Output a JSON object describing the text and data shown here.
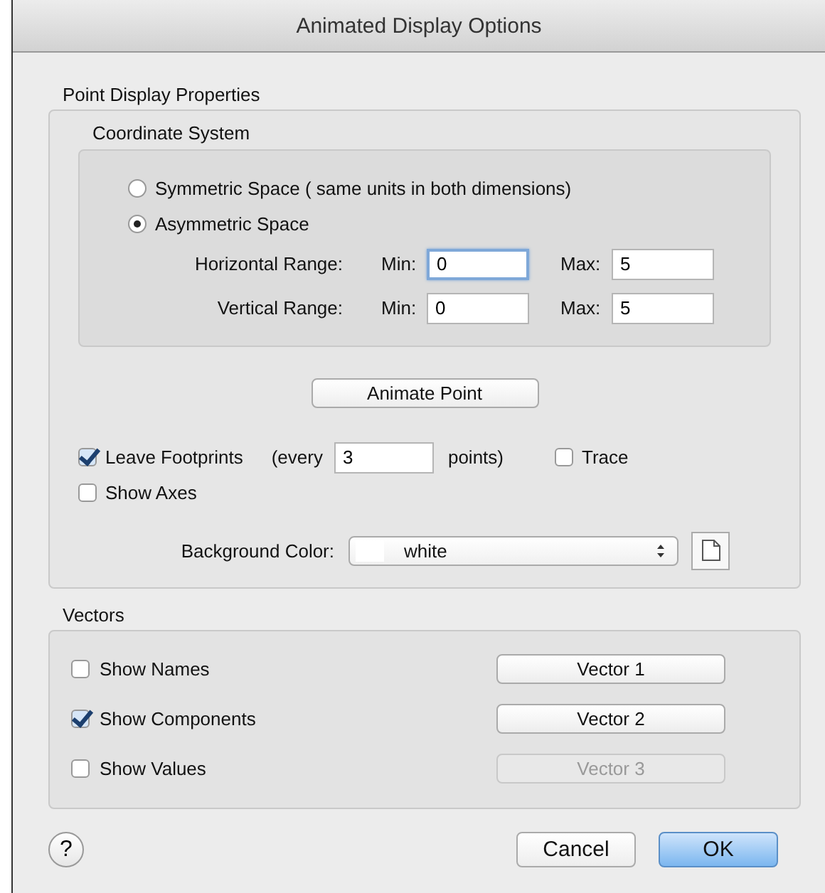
{
  "window": {
    "title": "Animated Display Options"
  },
  "point_display": {
    "label": "Point Display Properties",
    "coordinate_system": {
      "label": "Coordinate System",
      "options": [
        {
          "label": "Symmetric Space ( same units in both dimensions)",
          "selected": false
        },
        {
          "label": "Asymmetric Space",
          "selected": true
        }
      ],
      "ranges": [
        {
          "label": "Horizontal Range:",
          "min_label": "Min:",
          "min": "0",
          "min_focused": true,
          "max_label": "Max:",
          "max": "5"
        },
        {
          "label": "Vertical Range:",
          "min_label": "Min:",
          "min": "0",
          "min_focused": false,
          "max_label": "Max:",
          "max": "5"
        }
      ]
    },
    "animate_button": "Animate Point",
    "footprints": {
      "label": "Leave Footprints",
      "checked": true,
      "every_label": "(every",
      "every": "3",
      "points_label": "points)"
    },
    "trace": {
      "label": "Trace",
      "checked": false
    },
    "show_axes": {
      "label": "Show Axes",
      "checked": false
    },
    "background": {
      "label": "Background Color:",
      "value": "white"
    }
  },
  "vectors": {
    "label": "Vectors",
    "rows": [
      {
        "label": "Show Names",
        "checked": false,
        "button": "Vector 1",
        "disabled": false
      },
      {
        "label": "Show Components",
        "checked": true,
        "button": "Vector 2",
        "disabled": false
      },
      {
        "label": "Show Values",
        "checked": false,
        "button": "Vector 3",
        "disabled": true
      }
    ]
  },
  "help": "?",
  "buttons": [
    {
      "label": "Cancel",
      "default": false
    },
    {
      "label": "OK",
      "default": true
    }
  ]
}
